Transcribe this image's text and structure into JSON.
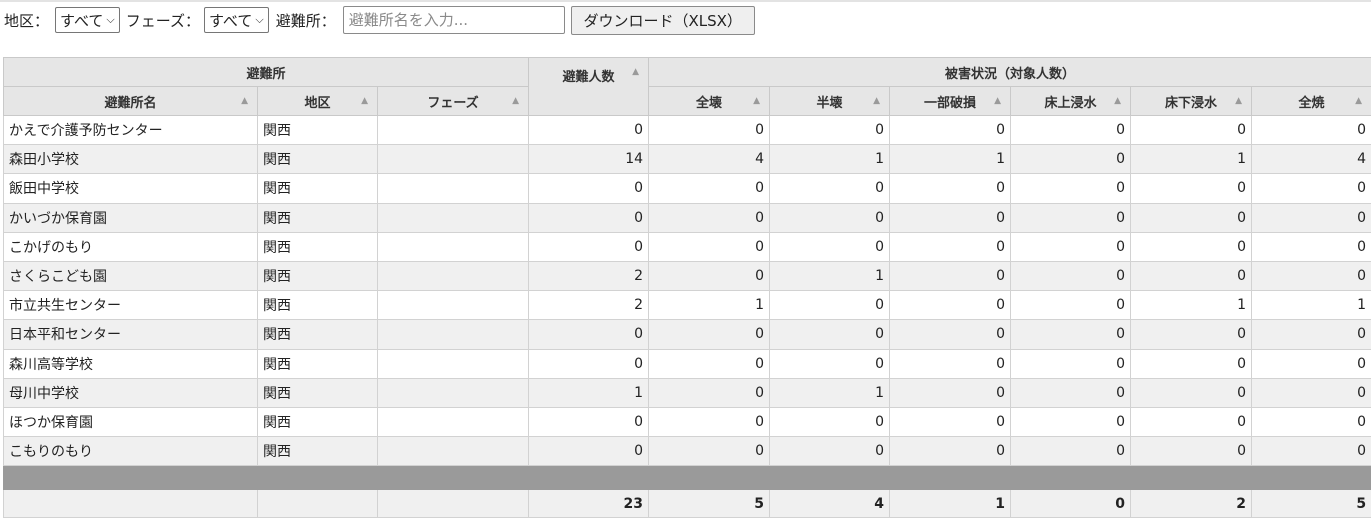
{
  "filters": {
    "area_label": "地区：",
    "area_value": "すべて",
    "phase_label": "フェーズ：",
    "phase_value": "すべて",
    "shelter_label": "避難所：",
    "shelter_placeholder": "避難所名を入力...",
    "download_label": "ダウンロード（XLSX）"
  },
  "table": {
    "group_headers": {
      "shelter": "避難所",
      "evacuees": "避難人数",
      "damage": "被害状況（対象人数）"
    },
    "columns": [
      "避難所名",
      "地区",
      "フェーズ",
      "全壊",
      "半壊",
      "一部破損",
      "床上浸水",
      "床下浸水",
      "全焼"
    ],
    "rows": [
      {
        "name": "かえで介護予防センター",
        "area": "関西",
        "phase": "",
        "evac": "0",
        "d1": "0",
        "d2": "0",
        "d3": "0",
        "d4": "0",
        "d5": "0",
        "d6": "0"
      },
      {
        "name": "森田小学校",
        "area": "関西",
        "phase": "",
        "evac": "14",
        "d1": "4",
        "d2": "1",
        "d3": "1",
        "d4": "0",
        "d5": "1",
        "d6": "4"
      },
      {
        "name": "飯田中学校",
        "area": "関西",
        "phase": "",
        "evac": "0",
        "d1": "0",
        "d2": "0",
        "d3": "0",
        "d4": "0",
        "d5": "0",
        "d6": "0"
      },
      {
        "name": "かいづか保育園",
        "area": "関西",
        "phase": "",
        "evac": "0",
        "d1": "0",
        "d2": "0",
        "d3": "0",
        "d4": "0",
        "d5": "0",
        "d6": "0"
      },
      {
        "name": "こかげのもり",
        "area": "関西",
        "phase": "",
        "evac": "0",
        "d1": "0",
        "d2": "0",
        "d3": "0",
        "d4": "0",
        "d5": "0",
        "d6": "0"
      },
      {
        "name": "さくらこども園",
        "area": "関西",
        "phase": "",
        "evac": "2",
        "d1": "0",
        "d2": "1",
        "d3": "0",
        "d4": "0",
        "d5": "0",
        "d6": "0"
      },
      {
        "name": "市立共生センター",
        "area": "関西",
        "phase": "",
        "evac": "2",
        "d1": "1",
        "d2": "0",
        "d3": "0",
        "d4": "0",
        "d5": "1",
        "d6": "1"
      },
      {
        "name": "日本平和センター",
        "area": "関西",
        "phase": "",
        "evac": "0",
        "d1": "0",
        "d2": "0",
        "d3": "0",
        "d4": "0",
        "d5": "0",
        "d6": "0"
      },
      {
        "name": "森川高等学校",
        "area": "関西",
        "phase": "",
        "evac": "0",
        "d1": "0",
        "d2": "0",
        "d3": "0",
        "d4": "0",
        "d5": "0",
        "d6": "0"
      },
      {
        "name": "母川中学校",
        "area": "関西",
        "phase": "",
        "evac": "1",
        "d1": "0",
        "d2": "1",
        "d3": "0",
        "d4": "0",
        "d5": "0",
        "d6": "0"
      },
      {
        "name": "ほつか保育園",
        "area": "関西",
        "phase": "",
        "evac": "0",
        "d1": "0",
        "d2": "0",
        "d3": "0",
        "d4": "0",
        "d5": "0",
        "d6": "0"
      },
      {
        "name": "こもりのもり",
        "area": "関西",
        "phase": "",
        "evac": "0",
        "d1": "0",
        "d2": "0",
        "d3": "0",
        "d4": "0",
        "d5": "0",
        "d6": "0"
      }
    ],
    "totals": {
      "evac": "23",
      "d1": "5",
      "d2": "4",
      "d3": "1",
      "d4": "0",
      "d5": "2",
      "d6": "5"
    }
  }
}
